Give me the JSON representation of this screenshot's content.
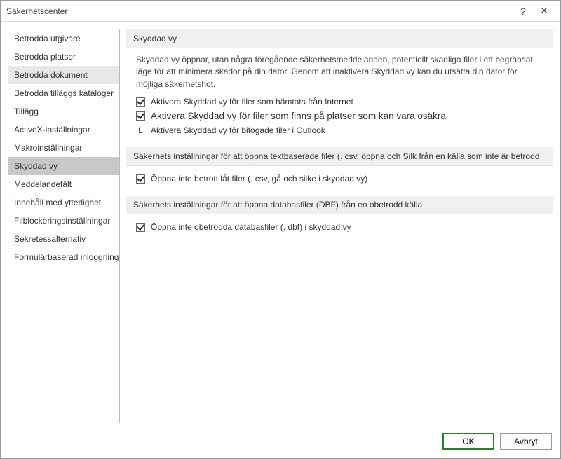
{
  "titlebar": {
    "title": "Säkerhetscenter",
    "help_label": "?",
    "close_label": "✕"
  },
  "sidebar": {
    "items": [
      {
        "label": "Betrodda utgivare"
      },
      {
        "label": "Betrodda platser"
      },
      {
        "label": "Betrodda dokument"
      },
      {
        "label": "Betrodda tilläggs kataloger"
      },
      {
        "label": "Tillägg"
      },
      {
        "label": "ActiveX-inställningar"
      },
      {
        "label": "Makroinställningar"
      },
      {
        "label": "Skyddad vy"
      },
      {
        "label": "Meddelandefält"
      },
      {
        "label": "Innehåll med ytterlighet"
      },
      {
        "label": "Filblockeringsinställningar"
      },
      {
        "label": "Sekretessalternativ"
      },
      {
        "label": "Formulärbaserad inloggning"
      }
    ]
  },
  "content": {
    "section1": {
      "header": "Skyddad vy",
      "desc": "Skyddad vy öppnar, utan några föregående säkerhetsmeddelanden, potentiellt skadliga filer i ett begränsat läge för att minimera skador på din dator. Genom att inaktivera Skyddad vy kan du utsätta din dator för möjliga säkerhetshot.",
      "opt1": "Aktivera Skyddad vy för filer som hämtats från Internet",
      "opt2": "Aktivera Skyddad vy för filer som finns på platser som kan vara osäkra",
      "opt3_prefix": "L",
      "opt3": "Aktivera Skyddad vy för bifogade filer i Outlook"
    },
    "section2": {
      "header": "Säkerhets inställningar för att öppna textbaserade filer (. csv, öppna och Silk från en källa som inte är betrodd",
      "opt1": "Öppna inte betrott låt filer (. csv, gå och silke i skyddad vy)"
    },
    "section3": {
      "header": "Säkerhets inställningar för att öppna databasfiler (DBF) från en obetrodd källa",
      "opt1": "Öppna inte obetrodda databasfiler (. dbf) i skyddad vy"
    }
  },
  "footer": {
    "ok": "OK",
    "cancel": "Avbryt"
  }
}
